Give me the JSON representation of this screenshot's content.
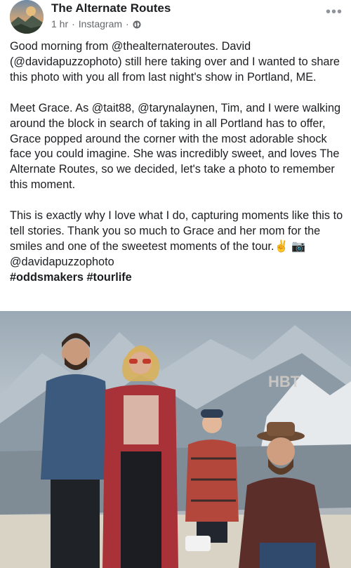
{
  "post": {
    "page_name": "The Alternate Routes",
    "time": "1 hr",
    "separator": "·",
    "source": "Instagram",
    "more_label": "•••",
    "paragraphs": [
      "Good morning from @thealternateroutes. David (@davidapuzzophoto) still here taking over and I wanted to share this photo with you all from last night's show in Portland, ME.",
      "Meet Grace. As @tait88, @tarynalaynen, Tim, and I were walking around the block in search of taking in all Portland has to offer, Grace popped around the corner with the most adorable shock face you could imagine. She was incredibly sweet, and loves The Alternate Routes, so we decided, let's take a photo to remember this moment.",
      "This is exactly why I love what I do,  capturing moments like this to tell stories. Thank you so much to Grace and her mom for the smiles and one of the sweetest moments of the tour."
    ],
    "emoji_line": "✌️ 📷 @davidapuzzophoto",
    "hashtags": "#oddsmakers #tourlife"
  },
  "icons": {
    "globe": "globe-icon",
    "more": "more-options-icon",
    "avatar": "page-avatar"
  },
  "colors": {
    "text": "#1c1e21",
    "meta": "#65676b",
    "background": "#ffffff"
  }
}
